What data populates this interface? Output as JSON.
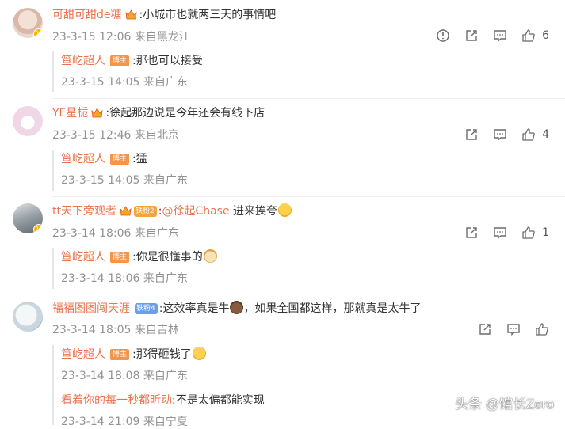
{
  "comments": [
    {
      "user": "可甜可甜de糖",
      "text": ":小城市也就两三天的事情吧",
      "time": "23-3-15 12:06",
      "location": "来自黑龙江",
      "likes": "6",
      "replies": [
        {
          "user": "笪屹超人",
          "badge": "博主",
          "text": ":那也可以接受",
          "time": "23-3-15 14:05",
          "location": "来自广东"
        }
      ]
    },
    {
      "user": "YE星栀",
      "text": ":徐起那边说是今年还会有线下店",
      "time": "23-3-15 12:46",
      "location": "来自北京",
      "likes": "4",
      "replies": [
        {
          "user": "笪屹超人",
          "badge": "博主",
          "text": ":猛",
          "time": "23-3-15 14:05",
          "location": "来自广东"
        }
      ]
    },
    {
      "user": "tt天下旁观者",
      "fans_badge": "铁粉2",
      "text_prefix": ":",
      "mention": "@徐起Chase",
      "text": " 进来挨夸",
      "time": "23-3-14 18:06",
      "location": "来自广东",
      "likes": "1",
      "replies": [
        {
          "user": "笪屹超人",
          "badge": "博主",
          "text": ":你是很懂事的",
          "time": "23-3-14 18:06",
          "location": "来自广东"
        }
      ]
    },
    {
      "user": "福福图图闯天涯",
      "fans_badge": "铁粉4",
      "text": ":这效率真是牛",
      "text_suffix": "，如果全国都这样，那就真是太牛了",
      "time": "23-3-14 18:05",
      "location": "来自吉林",
      "replies": [
        {
          "user": "笪屹超人",
          "badge": "博主",
          "text": ":那得砸钱了",
          "time": "23-3-14 18:08",
          "location": "来自广东"
        },
        {
          "user": "看着你的每一秒都昕动",
          "text": ":不是太偏都能实现",
          "time": "23-3-14 21:09",
          "location": "来自宁夏"
        }
      ]
    }
  ],
  "watermark": "头条 @馆长Zero",
  "colors": {
    "name": "#eb7350",
    "meta": "#939393",
    "blogger_badge": "#f79446"
  }
}
